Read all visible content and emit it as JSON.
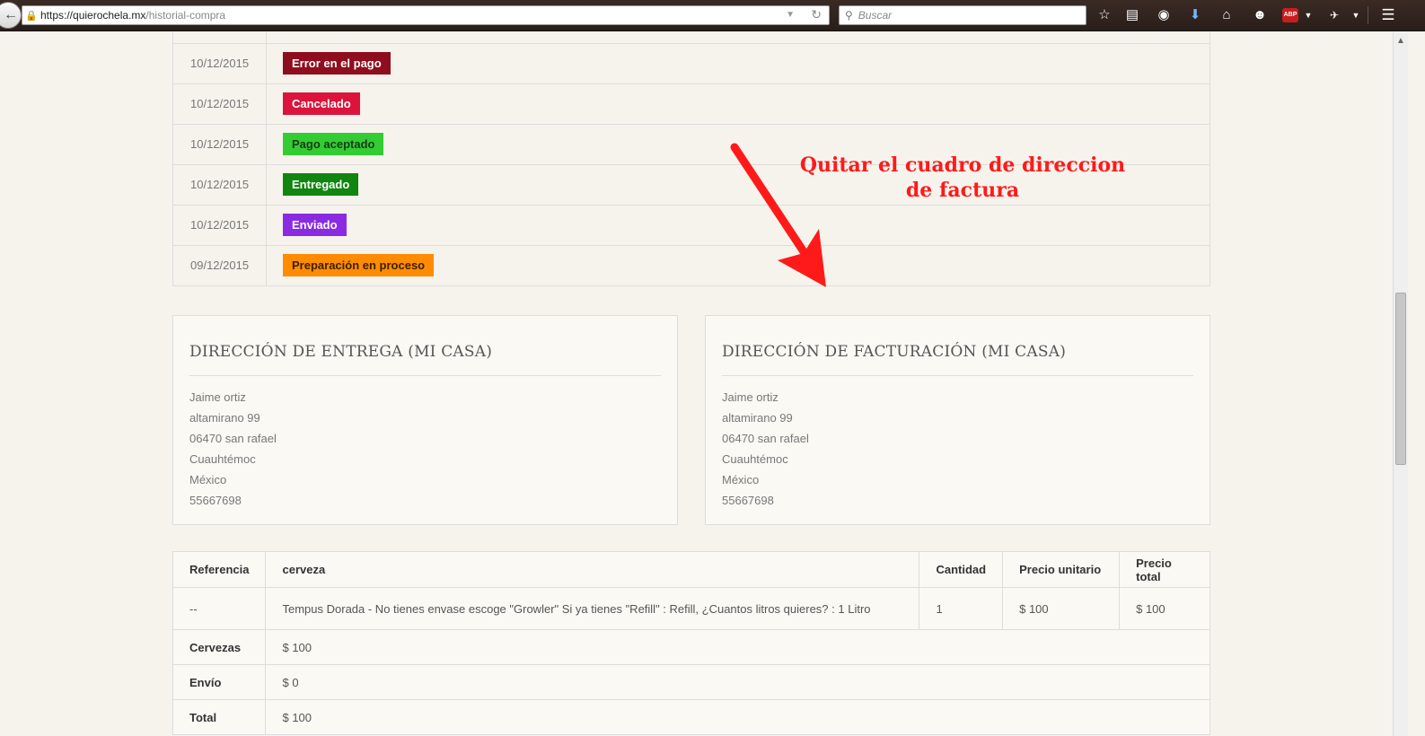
{
  "browser": {
    "url_domain": "https://quierochela.mx",
    "url_path": "/historial-compra",
    "search_placeholder": "Buscar",
    "abp_label": "ABP"
  },
  "status_history": [
    {
      "date": "10/12/2015",
      "state": "Error en el pago",
      "color": "#8f0e1e"
    },
    {
      "date": "10/12/2015",
      "state": "Cancelado",
      "color": "#dc143c"
    },
    {
      "date": "10/12/2015",
      "state": "Pago aceptado",
      "color": "#32cd32"
    },
    {
      "date": "10/12/2015",
      "state": "Entregado",
      "color": "#108510"
    },
    {
      "date": "10/12/2015",
      "state": "Enviado",
      "color": "#8a2be2"
    },
    {
      "date": "09/12/2015",
      "state": "Preparación en proceso",
      "color": "#ff8c00"
    }
  ],
  "delivery_address": {
    "title": "DIRECCIÓN DE ENTREGA (MI CASA)",
    "lines": [
      "Jaime ortiz",
      "altamirano 99",
      "06470 san rafael",
      "Cuauhtémoc",
      "México",
      "55667698"
    ]
  },
  "billing_address": {
    "title": "DIRECCIÓN DE FACTURACIÓN (MI CASA)",
    "lines": [
      "Jaime ortiz",
      "altamirano 99",
      "06470 san rafael",
      "Cuauhtémoc",
      "México",
      "55667698"
    ]
  },
  "order": {
    "headers": {
      "ref": "Referencia",
      "product": "cerveza",
      "qty": "Cantidad",
      "unit": "Precio unitario",
      "total": "Precio total"
    },
    "row": {
      "ref": "--",
      "product": "Tempus Dorada - No tienes envase escoge \"Growler\" Si ya tienes \"Refill\" : Refill, ¿Cuantos litros quieres? : 1 Litro",
      "qty": "1",
      "unit": "$ 100",
      "total": "$ 100"
    },
    "summary": [
      {
        "label": "Cervezas",
        "value": "$ 100",
        "highlight": true
      },
      {
        "label": "Envío",
        "value": "$ 0",
        "highlight": false
      },
      {
        "label": "Total",
        "value": "$ 100",
        "highlight": true
      }
    ]
  },
  "annotation": {
    "line1": "Quitar el cuadro de direccion",
    "line2": "de factura",
    "color": "#ff1a1a"
  }
}
